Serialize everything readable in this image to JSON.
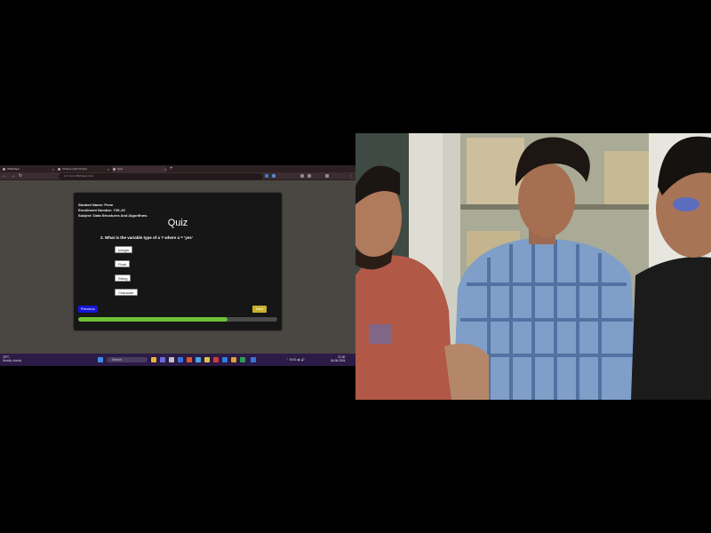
{
  "browser": {
    "tabs": [
      {
        "title": "WhatsApp"
      },
      {
        "title": "Chrome Quiz Project"
      },
      {
        "title": "Quiz"
      }
    ],
    "new_tab": "+",
    "url": "127.0.0.1:5500/quiz.html"
  },
  "quiz": {
    "student_name": "Student Name: Prem",
    "enrollment": "Enrollment Number: 72K-20",
    "subject": "Subject: Data Structures And Algorithms",
    "title": "Quiz",
    "question": "2. What is the variable type of a ? where a = 'yes'",
    "options": [
      "Integer",
      "Float",
      "String",
      "Character"
    ],
    "previous_label": "Previous",
    "next_label": "Next",
    "progress": 0.75,
    "progress_color": "#6fc134"
  },
  "taskbar": {
    "weather_temp": "28°C",
    "weather_desc": "Mostly cloudy",
    "search_placeholder": "Search",
    "tray_lang": "ENG",
    "time": "21:30",
    "date": "04-06-2024"
  }
}
